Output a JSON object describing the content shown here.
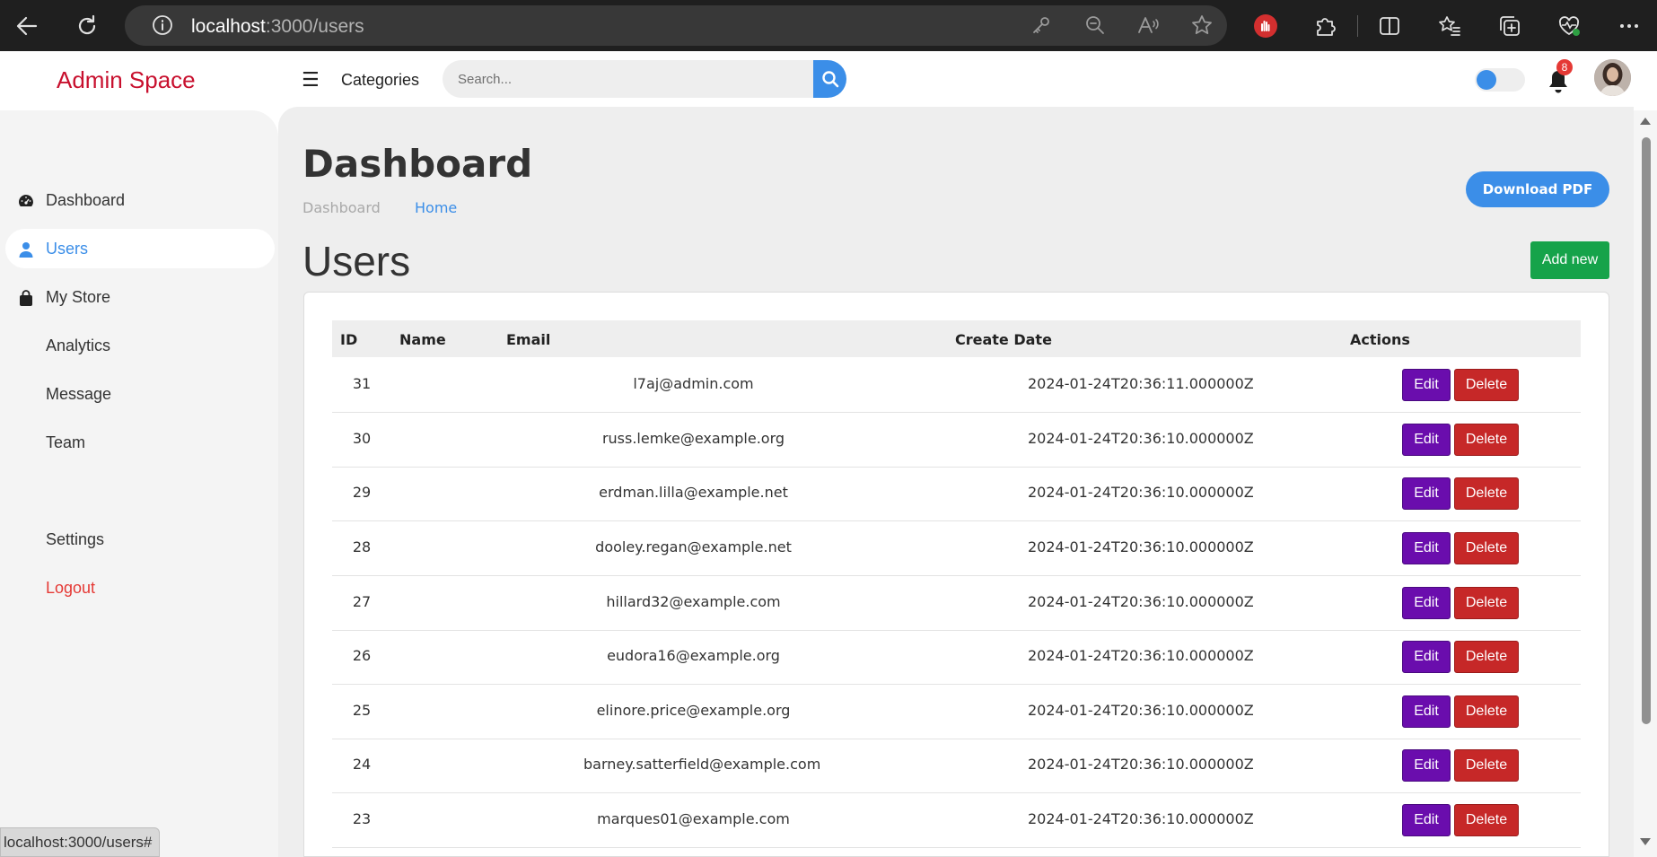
{
  "browser": {
    "url_host": "localhost",
    "url_rest": ":3000/users"
  },
  "header": {
    "brand": "Admin Space",
    "categories": "Categories",
    "search_placeholder": "Search...",
    "notification_count": "8"
  },
  "sidebar": {
    "items": [
      {
        "label": "Dashboard",
        "icon": "gauge-icon"
      },
      {
        "label": "Users",
        "icon": "user-icon",
        "active": true
      },
      {
        "label": "My Store",
        "icon": "bag-icon"
      },
      {
        "label": "Analytics"
      },
      {
        "label": "Message"
      },
      {
        "label": "Team"
      },
      {
        "label": "Settings"
      },
      {
        "label": "Logout"
      }
    ]
  },
  "main": {
    "title": "Dashboard",
    "breadcrumb": [
      "Dashboard",
      "Home"
    ],
    "download_pdf": "Download PDF",
    "users_title": "Users",
    "add_new": "Add new"
  },
  "table": {
    "headers": [
      "ID",
      "Name",
      "Email",
      "Create Date",
      "Actions"
    ],
    "rows": [
      {
        "id": "31",
        "name": "",
        "email": "l7aj@admin.com",
        "date": "2024-01-24T20:36:11.000000Z"
      },
      {
        "id": "30",
        "name": "",
        "email": "russ.lemke@example.org",
        "date": "2024-01-24T20:36:10.000000Z"
      },
      {
        "id": "29",
        "name": "",
        "email": "erdman.lilla@example.net",
        "date": "2024-01-24T20:36:10.000000Z"
      },
      {
        "id": "28",
        "name": "",
        "email": "dooley.regan@example.net",
        "date": "2024-01-24T20:36:10.000000Z"
      },
      {
        "id": "27",
        "name": "",
        "email": "hillard32@example.com",
        "date": "2024-01-24T20:36:10.000000Z"
      },
      {
        "id": "26",
        "name": "",
        "email": "eudora16@example.org",
        "date": "2024-01-24T20:36:10.000000Z"
      },
      {
        "id": "25",
        "name": "",
        "email": "elinore.price@example.org",
        "date": "2024-01-24T20:36:10.000000Z"
      },
      {
        "id": "24",
        "name": "",
        "email": "barney.satterfield@example.com",
        "date": "2024-01-24T20:36:10.000000Z"
      },
      {
        "id": "23",
        "name": "",
        "email": "marques01@example.com",
        "date": "2024-01-24T20:36:10.000000Z"
      }
    ],
    "edit_label": "Edit",
    "delete_label": "Delete"
  },
  "status_bar": "localhost:3000/users#",
  "colors": {
    "brand": "#c8102e",
    "accent": "#3b8ee8",
    "add_button": "#16a34a",
    "edit_button": "#6a0dad",
    "delete_button": "#c62828",
    "logout": "#e53935"
  }
}
